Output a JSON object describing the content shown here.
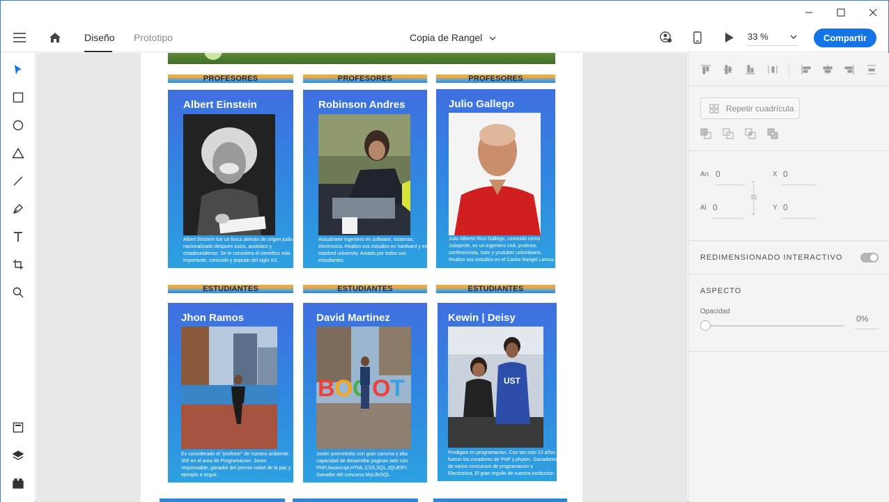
{
  "window": {
    "minimize": "minimize",
    "maximize": "maximize",
    "close": "close"
  },
  "appbar": {
    "tabs": [
      {
        "label": "Diseño"
      },
      {
        "label": "Prototipo"
      }
    ],
    "document_title": "Copia de Rangel",
    "zoom": "33 %",
    "share_label": "Compartir"
  },
  "toolbar": {
    "tools": [
      "select",
      "rectangle",
      "ellipse",
      "polygon",
      "line",
      "pen",
      "text",
      "artboard",
      "zoom"
    ],
    "bottom": [
      "assets",
      "layers",
      "plugins"
    ]
  },
  "artboard": {
    "sections": [
      {
        "label": "PROFESORES"
      },
      {
        "label": "ESTUDIANTES"
      }
    ],
    "professors": [
      {
        "name": "Albert Einstein",
        "description": "Albert Einstein fue un fisico alemán de origen judio, nacionalizado despues suizo, austriaco y estadounidense. Se le considera el científico más importante, conocido y popular del siglo XX."
      },
      {
        "name": "Robinson Andres",
        "description": "Actualmete ingeniero en software, sistemas, electronica. Realizo sus estudios en hardvard y en stanford university. Amado por todos sus estudiantes."
      },
      {
        "name": "Julio Gallego",
        "description": "Julio Alberto Rios Gallego, conocido como Julioprofe, es un ingeniero civil, profesor, conferencista, tutor y youtuber colombiano. Realizo sus estudios en el Carlos Rangel Lamus."
      }
    ],
    "students": [
      {
        "name": "Jhon Ramos",
        "description": "Es considerado el \"profesor\" de nuestro ambiente 300 en el area de Programacion. Joven responsable, ganador del premio nobel de la paz y ejemplo a seguir."
      },
      {
        "name": "David Martinez",
        "description": "Joven prometedor con gran carisma y alta capacidad de desarrollar paginas web con PHP,Javascript,HTML,CSS,SQL,JQUERY. Ganador del concurso MyLifeSQL."
      },
      {
        "name": "Kewin | Deisy",
        "description": "Prodigios en programacion. Con tan solo 10 años fueron los creadores de PHP y phyton. Ganadores de varios concursos de programacion y Electronica, El gran orgullo de nuestra institucion."
      }
    ]
  },
  "panel": {
    "repeat_grid": "Repetir cuadrícula",
    "width_label": "An",
    "width_value": "0",
    "height_label": "Al",
    "height_value": "0",
    "x_label": "X",
    "x_value": "0",
    "y_label": "Y",
    "y_value": "0",
    "responsive_resize": "REDIMENSIONADO INTERACTIVO",
    "appearance": "ASPECTO",
    "opacity_label": "Opacidad",
    "opacity_value": "0%"
  }
}
